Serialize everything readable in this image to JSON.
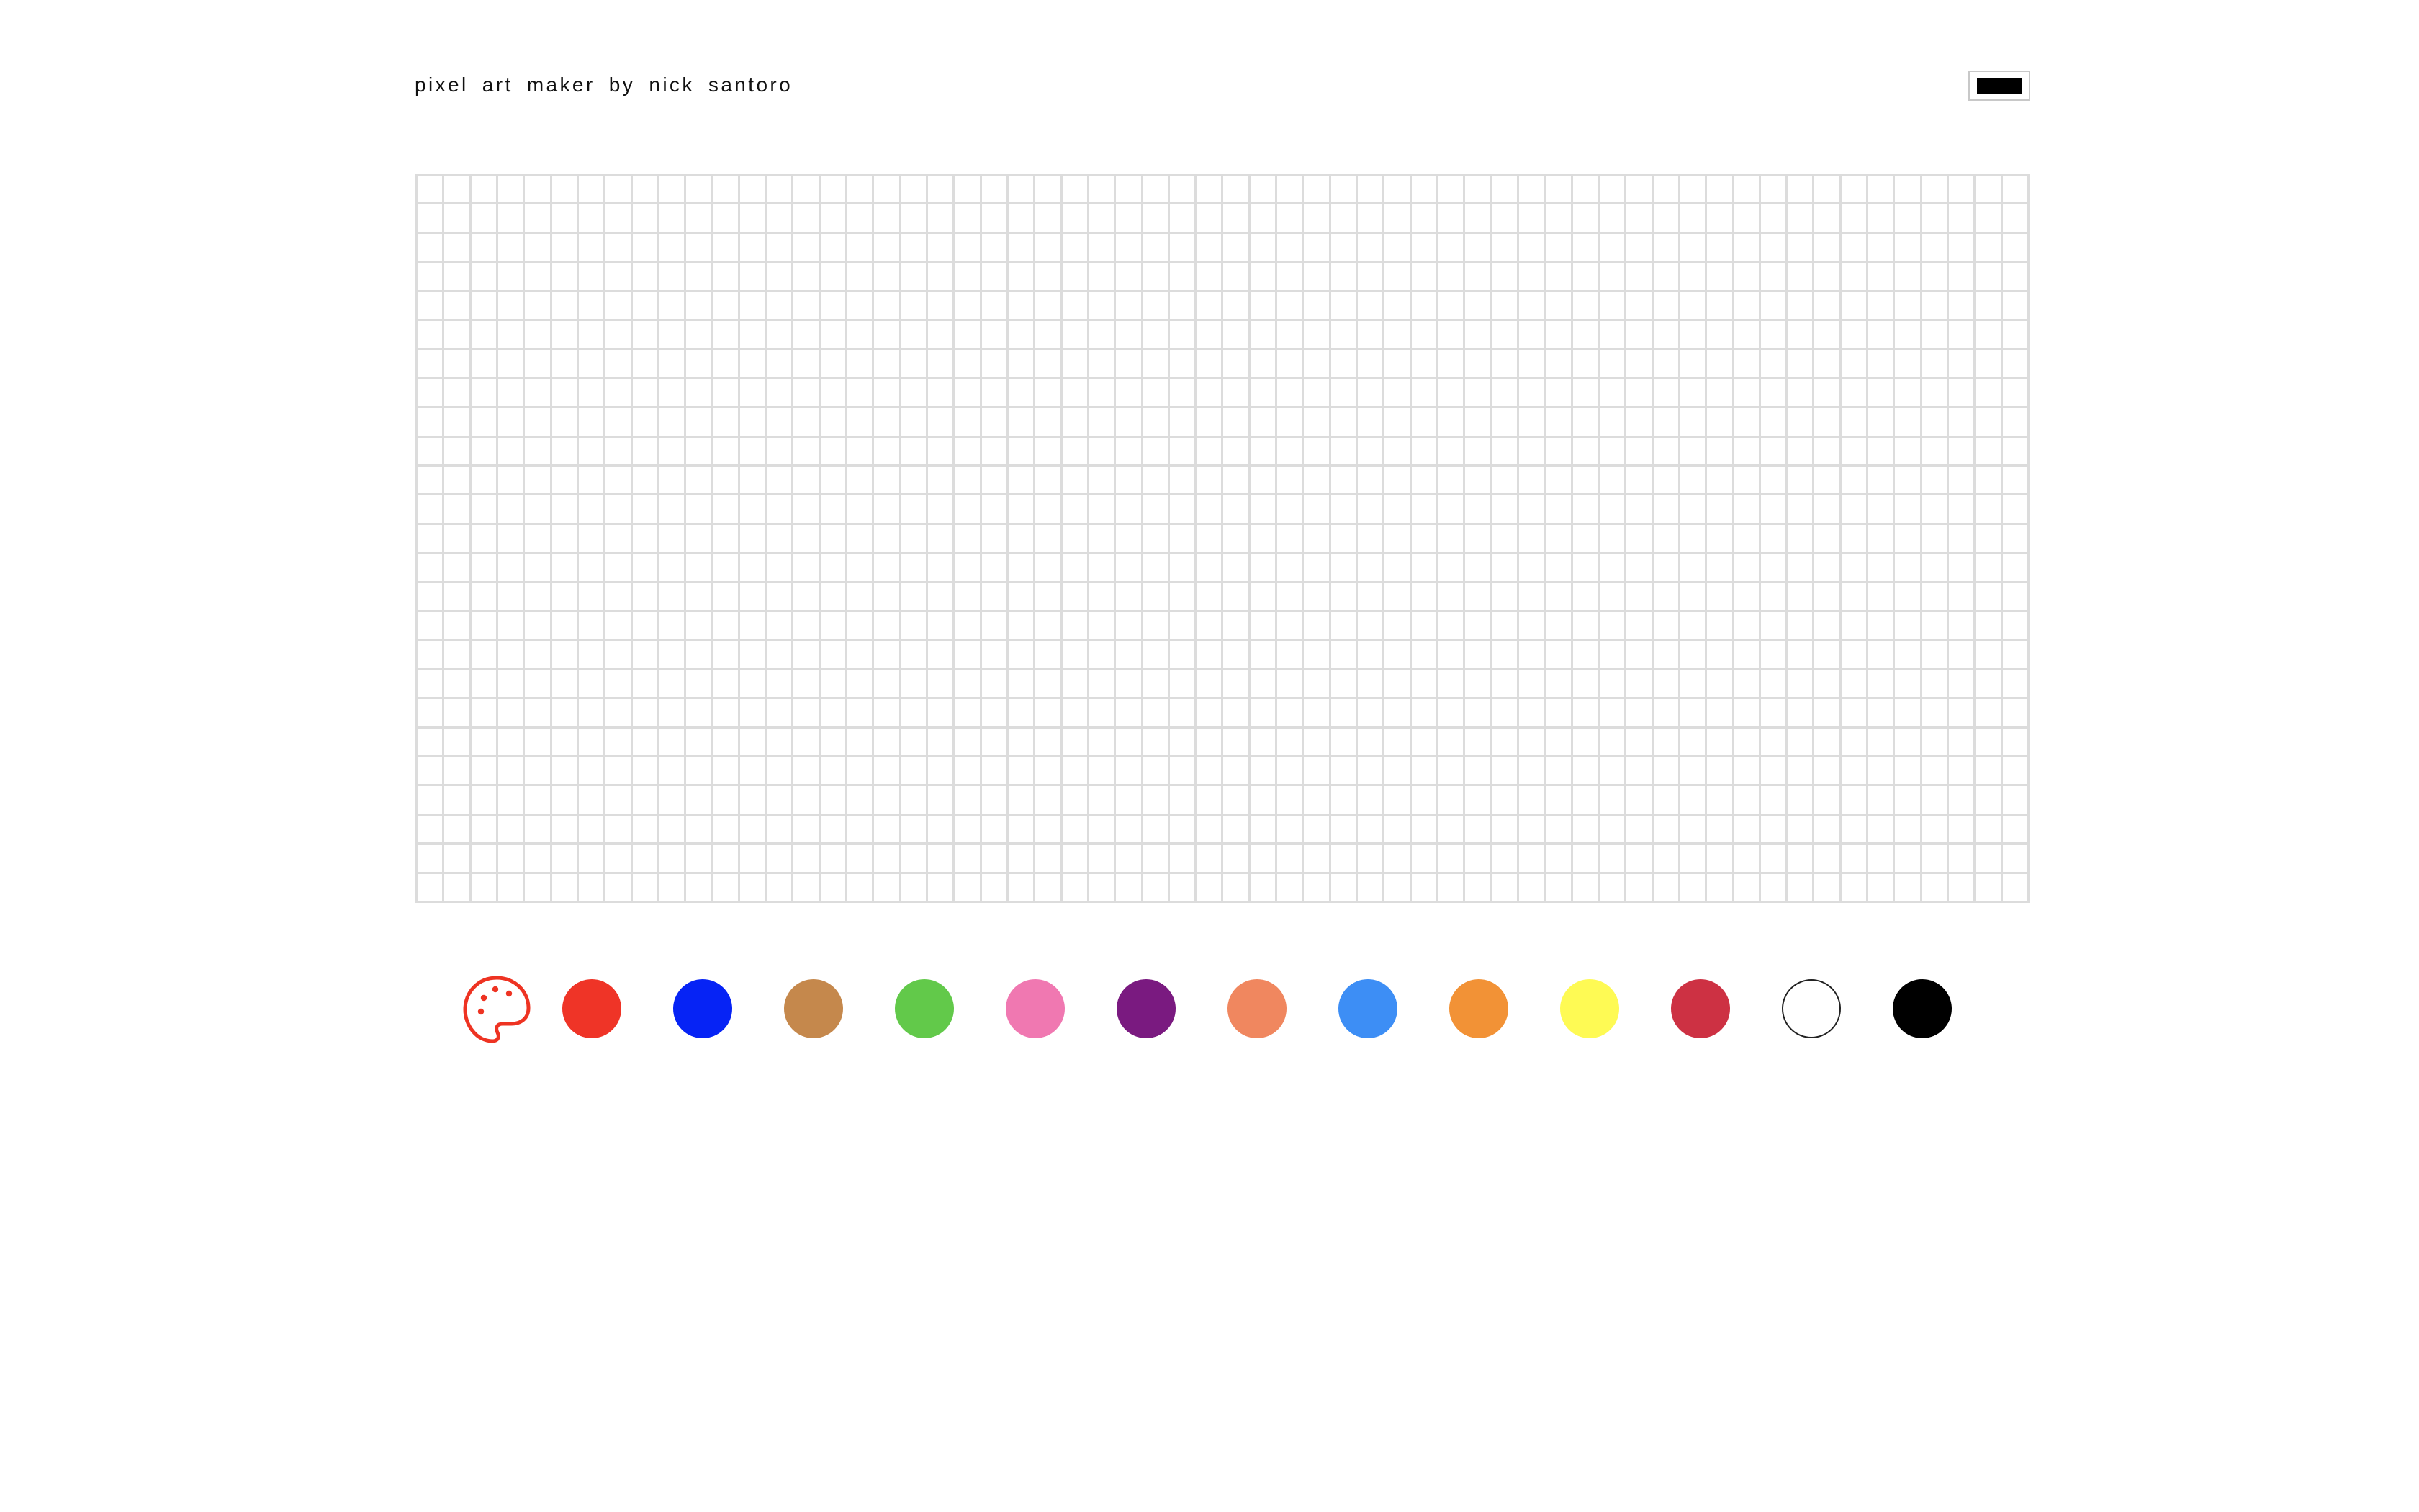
{
  "header": {
    "title": "pixel art maker by nick santoro"
  },
  "current_color": {
    "value": "#000000"
  },
  "canvas": {
    "columns": 60,
    "rows": 25,
    "cell_color": "#ffffff",
    "grid_line_color": "#dcdcdc"
  },
  "palette": {
    "icon": "palette-icon",
    "icon_color": "#ee3322",
    "colors": [
      {
        "name": "red",
        "hex": "#ef3427"
      },
      {
        "name": "blue",
        "hex": "#0623f5"
      },
      {
        "name": "brown",
        "hex": "#c5884c"
      },
      {
        "name": "green",
        "hex": "#62c94a"
      },
      {
        "name": "pink",
        "hex": "#f078b1"
      },
      {
        "name": "purple",
        "hex": "#7a1a80"
      },
      {
        "name": "salmon",
        "hex": "#f0875f"
      },
      {
        "name": "sky-blue",
        "hex": "#3d8ef5"
      },
      {
        "name": "orange",
        "hex": "#f29236"
      },
      {
        "name": "yellow",
        "hex": "#fefa54"
      },
      {
        "name": "crimson",
        "hex": "#cd3143"
      },
      {
        "name": "white",
        "hex": "#ffffff"
      },
      {
        "name": "black",
        "hex": "#000000"
      }
    ]
  }
}
